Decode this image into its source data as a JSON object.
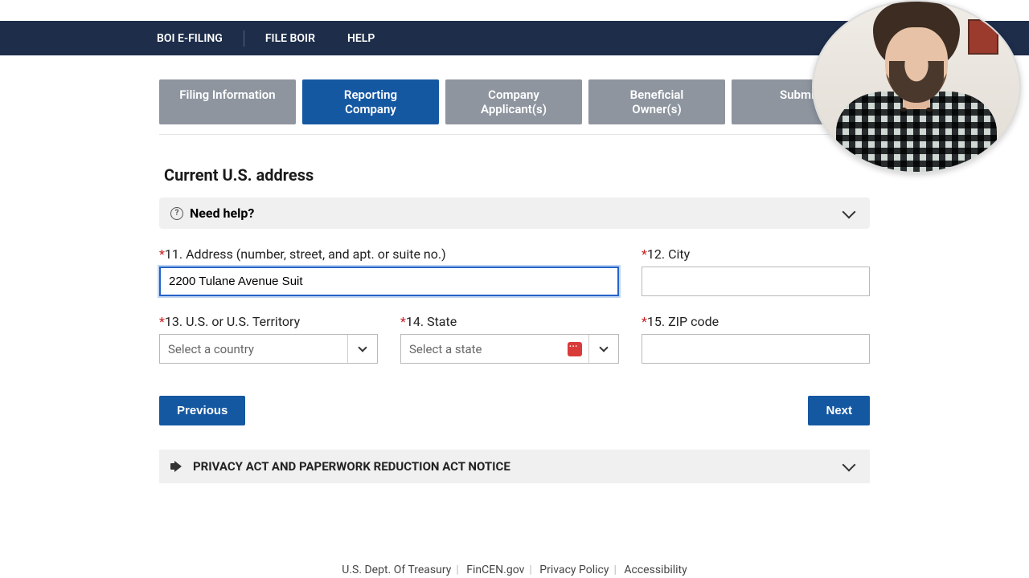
{
  "nav": {
    "brand": "BOI E-FILING",
    "file": "FILE BOIR",
    "help": "HELP"
  },
  "tabs": [
    {
      "label": "Filing Information"
    },
    {
      "label": "Reporting Company"
    },
    {
      "label": "Company Applicant(s)"
    },
    {
      "label": "Beneficial Owner(s)"
    },
    {
      "label": "Submit"
    }
  ],
  "section_title": "Current U.S. address",
  "help_bar": {
    "label": "Need help?"
  },
  "fields": {
    "address": {
      "label": "11. Address (number, street, and apt. or suite no.)",
      "value": "2200 Tulane Avenue Suit"
    },
    "city": {
      "label": "12. City",
      "value": ""
    },
    "territory": {
      "label": "13. U.S. or U.S. Territory",
      "placeholder": "Select a country"
    },
    "state": {
      "label": "14. State",
      "placeholder": "Select a state"
    },
    "zip": {
      "label": "15. ZIP code",
      "value": ""
    }
  },
  "buttons": {
    "prev": "Previous",
    "next": "Next"
  },
  "notice": "PRIVACY ACT AND PAPERWORK REDUCTION ACT NOTICE",
  "footer": {
    "a": "U.S. Dept. Of Treasury",
    "b": "FinCEN.gov",
    "c": "Privacy Policy",
    "d": "Accessibility"
  }
}
